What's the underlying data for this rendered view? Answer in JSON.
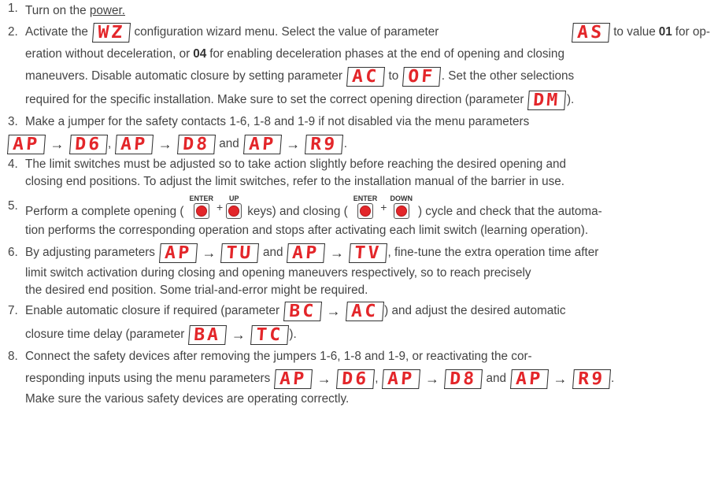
{
  "steps": [
    {
      "num": "1.",
      "lines": [
        {
          "p0": "Turn on the ",
          "p1": "power."
        }
      ]
    },
    {
      "num": "2.",
      "lines": [
        {
          "p0": "Activate the",
          "d0": "WZ",
          "p1": "configuration wizard menu. Select the value of parameter",
          "d1": "AS",
          "p2": "to value",
          "b0": "01",
          "p3": "for op-"
        },
        {
          "p0": "eration without deceleration, or",
          "b0": "04",
          "p1": "for enabling deceleration phases at the end of opening and closing"
        },
        {
          "p0": "maneuvers. Disable automatic closure by setting parameter",
          "d0": "AC",
          "p1": "to",
          "d1": "OF",
          "p2": ". Set the other selections"
        },
        {
          "p0": "required for the specific installation. Make sure to set the correct opening direction (parameter",
          "d0": "DM",
          "p1": ")."
        }
      ]
    },
    {
      "num": "3.",
      "lines": [
        {
          "p0": "Make a jumper for the safety contacts 1-6, 1-8 and 1-9 if not disabled via the menu parameters"
        },
        {
          "d0": "AP",
          "d1": "D6",
          "p0": ",",
          "d2": "AP",
          "d3": "D8",
          "p1": "and",
          "d4": "AP",
          "d5": "R9",
          "p2": "."
        }
      ]
    },
    {
      "num": "4.",
      "lines": [
        {
          "p0": "The limit switches must be adjusted so to take action slightly before reaching the desired opening and"
        },
        {
          "p0": "closing end positions. To adjust the limit switches, refer to the installation manual of the barrier in use."
        }
      ]
    },
    {
      "num": "5.",
      "lines": [
        {
          "p0": "Perform a complete opening (",
          "k0": "ENTER",
          "k1": "UP",
          "p1": "keys) and closing (",
          "k2": "ENTER",
          "k3": "DOWN",
          "p2": ") cycle and check that the automa-"
        },
        {
          "p0": "tion performs the corresponding operation and stops after activating each limit switch (learning operation)."
        }
      ]
    },
    {
      "num": "6.",
      "lines": [
        {
          "p0": "By adjusting parameters",
          "d0": "AP",
          "d1": "TU",
          "p1": "and",
          "d2": "AP",
          "d3": "TV",
          "p2": ", fine-tune the extra operation time after"
        },
        {
          "p0": "limit switch activation during closing and opening maneuvers respectively, so to reach precisely"
        },
        {
          "p0": "the desired end position. Some trial-and-error might be required."
        }
      ]
    },
    {
      "num": "7.",
      "lines": [
        {
          "p0": "Enable automatic closure if required (parameter",
          "d0": "BC",
          "d1": "AC",
          "p1": ") and adjust the desired automatic"
        },
        {
          "p0": "closure time delay (parameter",
          "d0": "BA",
          "d1": "TC",
          "p1": ")."
        }
      ]
    },
    {
      "num": "8.",
      "lines": [
        {
          "p0": "Connect the safety devices after removing the jumpers 1-6, 1-8 and 1-9, or reactivating the cor-"
        },
        {
          "p0": "responding inputs using the menu parameters",
          "d0": "AP",
          "d1": "D6",
          "p1": ",",
          "d2": "AP",
          "d3": "D8",
          "p2": "and",
          "d4": "AP",
          "d5": "R9",
          "p3": "."
        },
        {
          "p0": "Make sure the various safety devices are operating correctly."
        }
      ]
    }
  ],
  "arrow_glyph": "→",
  "plus_glyph": "+",
  "colors": {
    "text": "#444444",
    "display_digits": "#e3262a",
    "key_button": "#e3262a"
  }
}
